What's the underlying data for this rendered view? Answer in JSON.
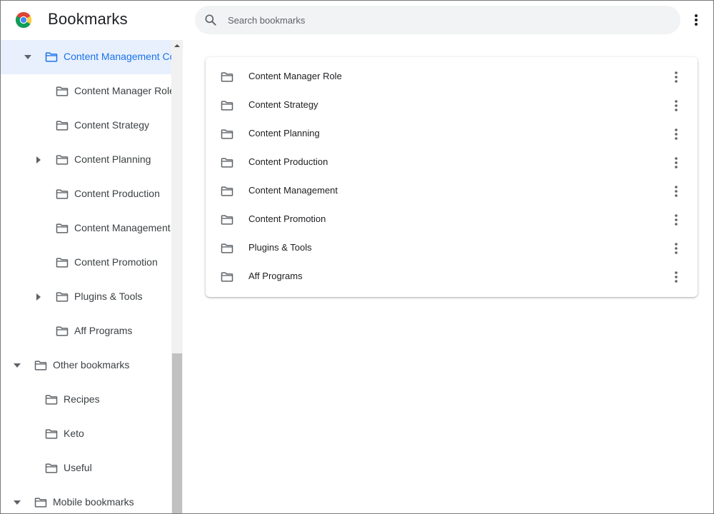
{
  "app": {
    "title": "Bookmarks",
    "logo_icon": "chrome-logo-icon"
  },
  "search": {
    "placeholder": "Search bookmarks",
    "value": ""
  },
  "colors": {
    "accent": "#1a73e8",
    "selected_bg": "#e8f0fe",
    "folder_icon": "#5f6368"
  },
  "sidebar": {
    "items": [
      {
        "label": "Content Management Co",
        "expanded": true,
        "selected": true
      },
      {
        "label": "Content Manager Role",
        "expanded": false
      },
      {
        "label": "Content Strategy",
        "expanded": false
      },
      {
        "label": "Content Planning",
        "expanded": false
      },
      {
        "label": "Content Production",
        "expanded": false
      },
      {
        "label": "Content Management",
        "expanded": false
      },
      {
        "label": "Content Promotion",
        "expanded": false
      },
      {
        "label": "Plugins & Tools",
        "expanded": false
      },
      {
        "label": "Aff Programs",
        "expanded": false
      },
      {
        "label": "Other bookmarks",
        "expanded": true
      },
      {
        "label": "Recipes",
        "expanded": false
      },
      {
        "label": "Keto",
        "expanded": false
      },
      {
        "label": "Useful",
        "expanded": false
      },
      {
        "label": "Mobile bookmarks",
        "expanded": true
      }
    ]
  },
  "main": {
    "items": [
      {
        "label": "Content Manager Role"
      },
      {
        "label": "Content Strategy"
      },
      {
        "label": "Content Planning"
      },
      {
        "label": "Content Production"
      },
      {
        "label": "Content Management"
      },
      {
        "label": "Content Promotion"
      },
      {
        "label": "Plugins & Tools"
      },
      {
        "label": "Aff Programs"
      }
    ]
  }
}
